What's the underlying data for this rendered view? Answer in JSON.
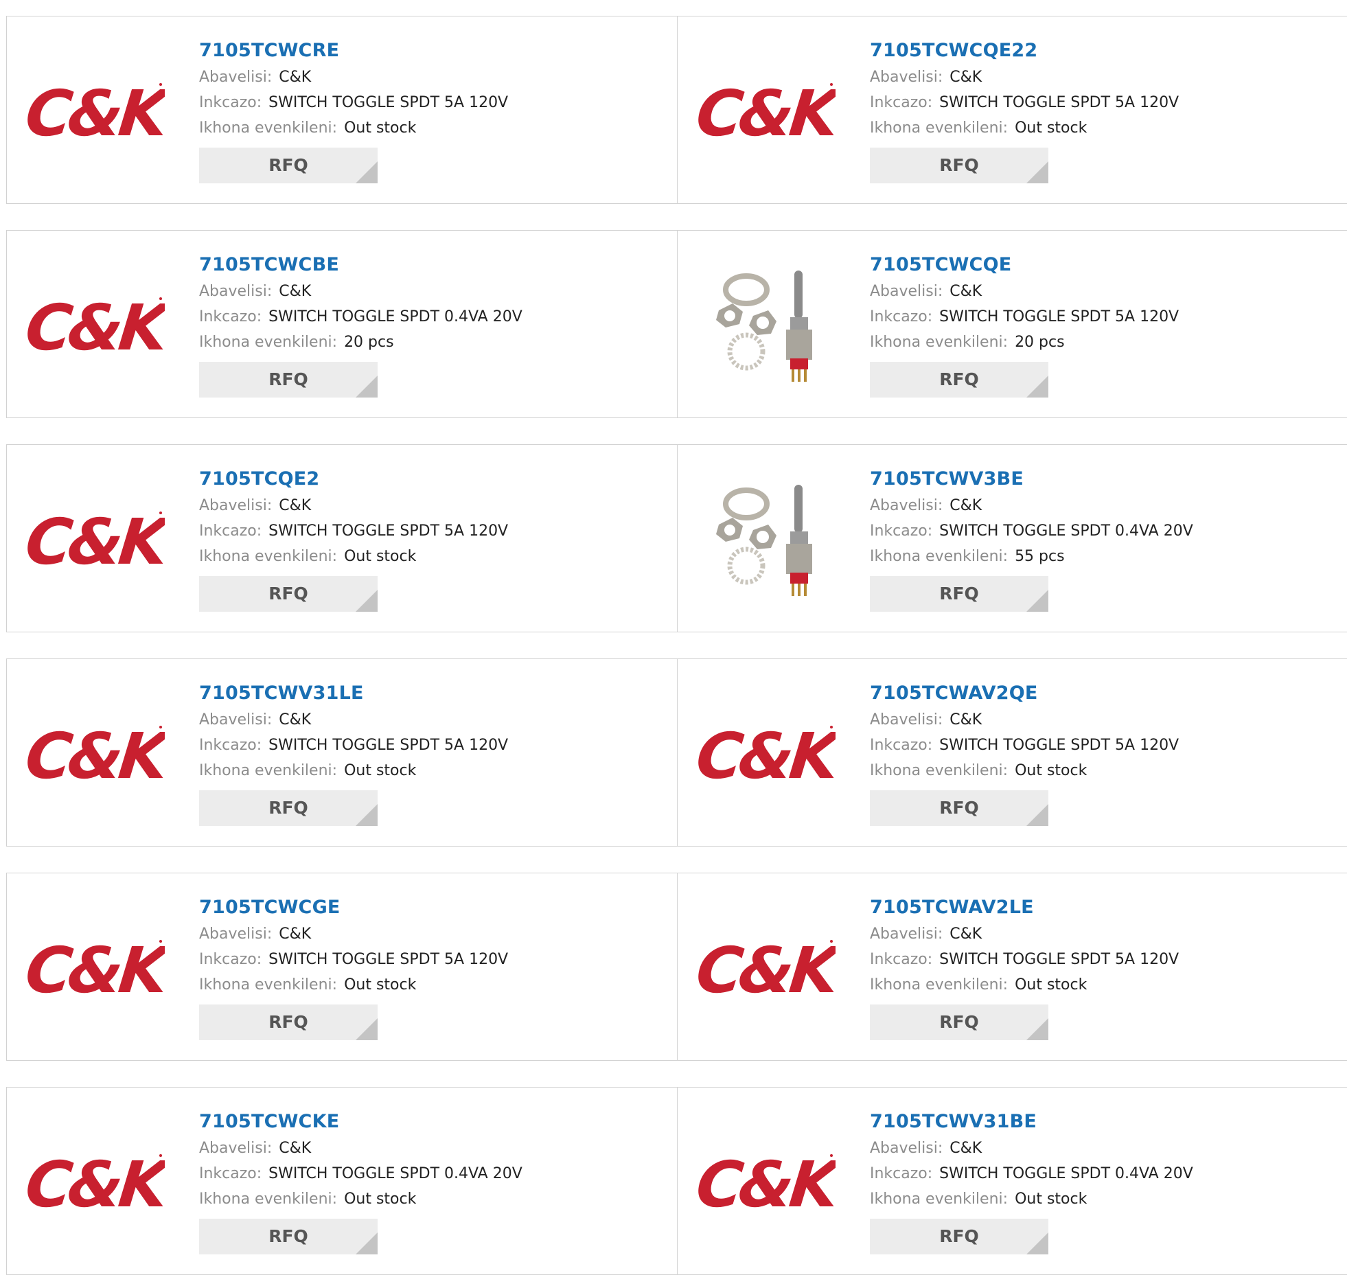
{
  "labels": {
    "manufacturer": "Abavelisi:",
    "description": "Inkcazo:",
    "stock": "Ikhona evenkileni:",
    "rfq": "RFQ"
  },
  "logo_text": "C&K",
  "colors": {
    "link": "#1a6fb3",
    "logo_red": "#c8202f",
    "border": "#d2d2d2",
    "button_bg": "#ececec"
  },
  "products": [
    {
      "part": "7105TCWCRE",
      "manufacturer": "C&K",
      "description": "SWITCH TOGGLE SPDT 5A 120V",
      "stock": "Out stock",
      "image": "ck-logo"
    },
    {
      "part": "7105TCWCQE22",
      "manufacturer": "C&K",
      "description": "SWITCH TOGGLE SPDT 5A 120V",
      "stock": "Out stock",
      "image": "ck-logo"
    },
    {
      "part": "7105TCWCBE",
      "manufacturer": "C&K",
      "description": "SWITCH TOGGLE SPDT 0.4VA 20V",
      "stock": "20 pcs",
      "image": "ck-logo"
    },
    {
      "part": "7105TCWCQE",
      "manufacturer": "C&K",
      "description": "SWITCH TOGGLE SPDT 5A 120V",
      "stock": "20 pcs",
      "image": "toggle-switch-photo"
    },
    {
      "part": "7105TCQE2",
      "manufacturer": "C&K",
      "description": "SWITCH TOGGLE SPDT 5A 120V",
      "stock": "Out stock",
      "image": "ck-logo"
    },
    {
      "part": "7105TCWV3BE",
      "manufacturer": "C&K",
      "description": "SWITCH TOGGLE SPDT 0.4VA 20V",
      "stock": "55 pcs",
      "image": "toggle-switch-photo"
    },
    {
      "part": "7105TCWV31LE",
      "manufacturer": "C&K",
      "description": "SWITCH TOGGLE SPDT 5A 120V",
      "stock": "Out stock",
      "image": "ck-logo"
    },
    {
      "part": "7105TCWAV2QE",
      "manufacturer": "C&K",
      "description": "SWITCH TOGGLE SPDT 5A 120V",
      "stock": "Out stock",
      "image": "ck-logo"
    },
    {
      "part": "7105TCWCGE",
      "manufacturer": "C&K",
      "description": "SWITCH TOGGLE SPDT 5A 120V",
      "stock": "Out stock",
      "image": "ck-logo"
    },
    {
      "part": "7105TCWAV2LE",
      "manufacturer": "C&K",
      "description": "SWITCH TOGGLE SPDT 5A 120V",
      "stock": "Out stock",
      "image": "ck-logo"
    },
    {
      "part": "7105TCWCKE",
      "manufacturer": "C&K",
      "description": "SWITCH TOGGLE SPDT 0.4VA 20V",
      "stock": "Out stock",
      "image": "ck-logo"
    },
    {
      "part": "7105TCWV31BE",
      "manufacturer": "C&K",
      "description": "SWITCH TOGGLE SPDT 0.4VA 20V",
      "stock": "Out stock",
      "image": "ck-logo"
    }
  ]
}
